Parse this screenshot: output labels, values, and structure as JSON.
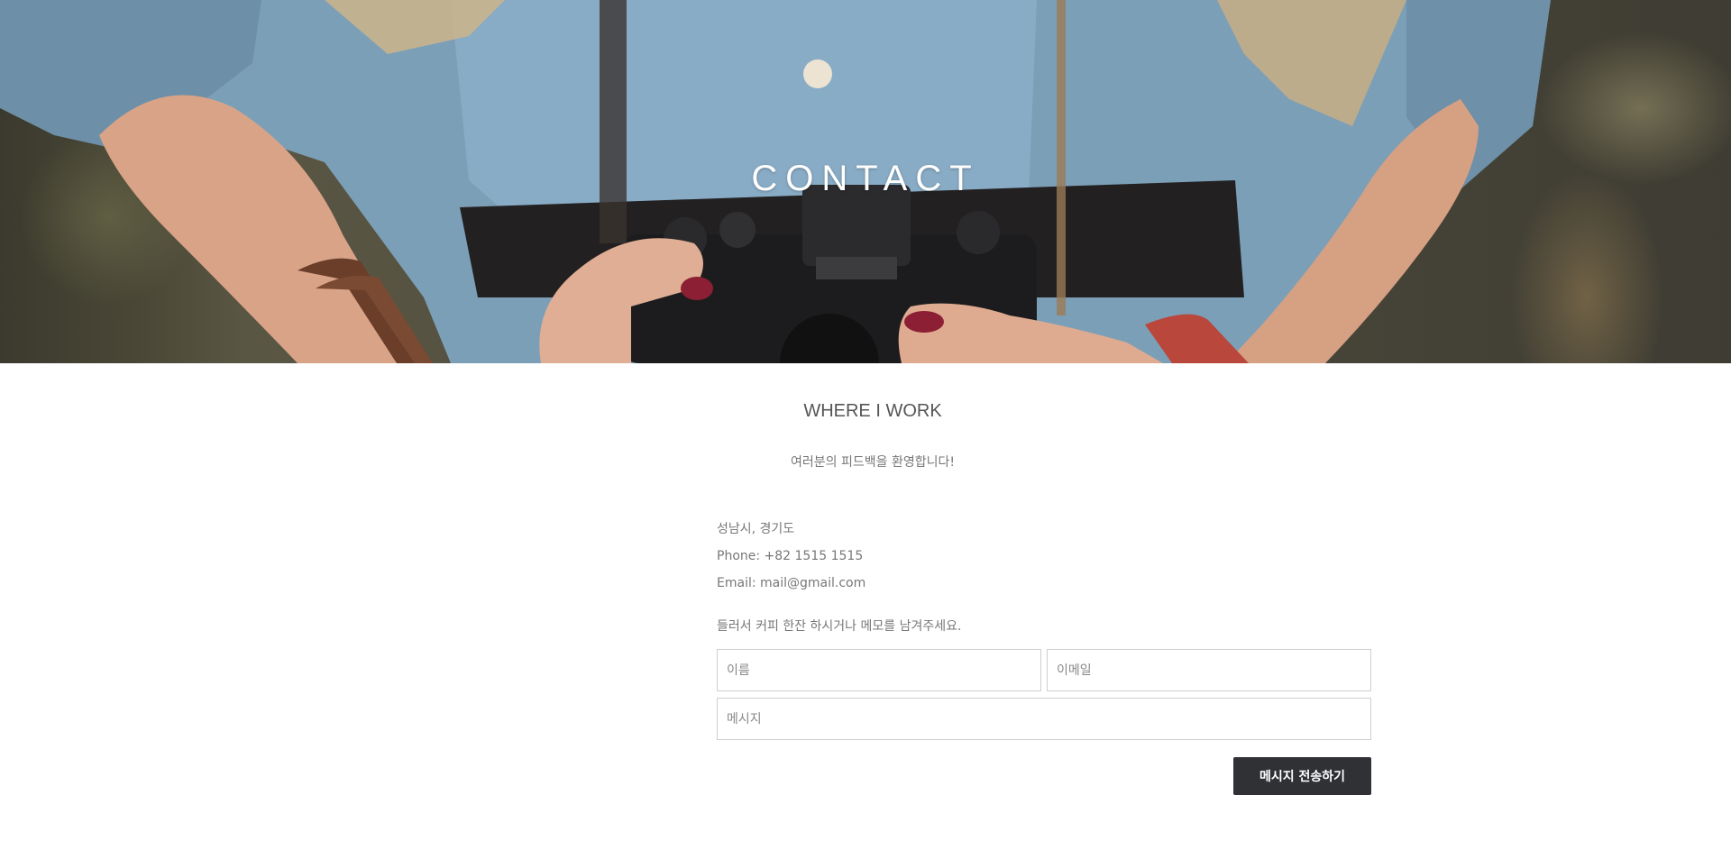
{
  "hero": {
    "title": "CONTACT",
    "image": "woman-with-vintage-camera-photo"
  },
  "section": {
    "title": "WHERE I WORK",
    "subtitle": "여러분의 피드백을 환영합니다!"
  },
  "contact_info": {
    "address": "성남시, 경기도",
    "phone": "Phone: +82 1515 1515",
    "email": "Email: mail@gmail.com"
  },
  "form": {
    "intro": "들러서 커피 한잔 하시거나 메모를 남겨주세요.",
    "name_placeholder": "이름",
    "email_placeholder": "이메일",
    "message_placeholder": "메시지",
    "submit_label": "메시지 전송하기"
  },
  "colors": {
    "button_bg": "#2f3135",
    "text": "#777777"
  }
}
